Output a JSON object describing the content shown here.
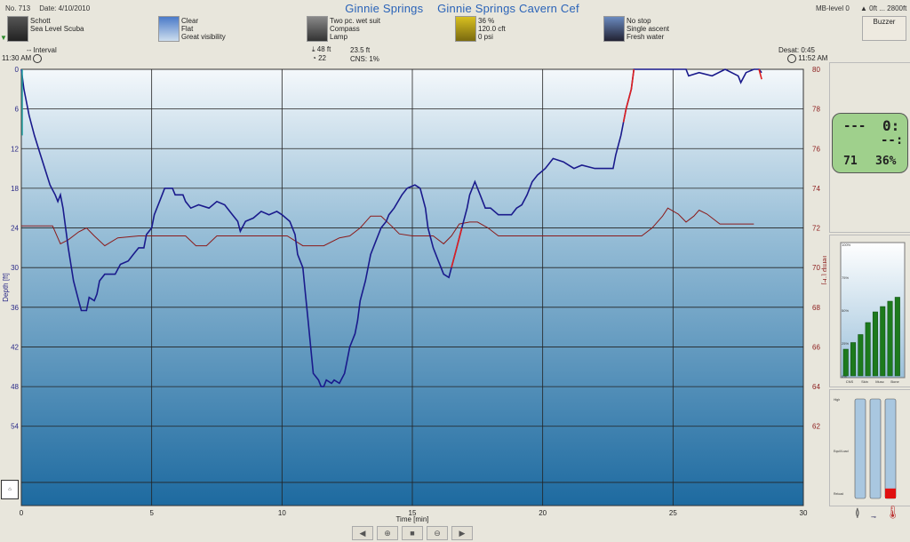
{
  "header": {
    "dive_no": "No. 713",
    "date": "Date: 4/10/2010",
    "title_site": "Ginnie Springs",
    "title_location": "Ginnie Springs Cavern Cef",
    "mb_level": "MB-level 0",
    "altitude": "0ft ... 2800ft",
    "buzzer_label": "Buzzer"
  },
  "info": {
    "diver": [
      "Schott",
      "Sea Level Scuba"
    ],
    "weather": [
      "Clear",
      "Flat",
      "Great visibility"
    ],
    "equipment": [
      "Two pc. wet suit",
      "Compass",
      "Lamp"
    ],
    "tank": [
      "36 %",
      "120.0 cft",
      "0 psi"
    ],
    "deco": [
      "No stop",
      "Single ascent",
      "Fresh water"
    ]
  },
  "subheader": {
    "interval_label": "--  Interval",
    "start_time": "11:30 AM",
    "max_depth": "48 ft",
    "avg_depth": "23.5 ft",
    "cns_left": "22",
    "cns": "CNS:  1%",
    "desat": "Desat:  0:45",
    "end_time": "11:52 AM"
  },
  "computer": {
    "top_left": "---",
    "top_right": "0:",
    "mid_right": "--:",
    "bottom_left": "71",
    "bottom_right": "36%"
  },
  "bars_panel": {
    "labels": [
      "CNS",
      "Skin",
      "Musc",
      "Bone"
    ],
    "y_labels": [
      "100%",
      "75%",
      "50%",
      "25%",
      "0%"
    ],
    "values": [
      0.2,
      0.25,
      0.31,
      0.4,
      0.48,
      0.52,
      0.56,
      0.59
    ]
  },
  "tissue_panel": {
    "labels": [
      "High",
      "Equil/Load",
      "Reload"
    ],
    "values": [
      0,
      0,
      0.1
    ]
  },
  "chart_data": {
    "type": "line",
    "xlabel": "Time [min]",
    "ylabel": "Depth [ft]",
    "y2label": "Temp [°F]",
    "xlim": [
      0,
      30
    ],
    "ylim": [
      66,
      0
    ],
    "y2lim": [
      58,
      80
    ],
    "x_ticks": [
      0,
      5,
      10,
      15,
      20,
      25,
      30
    ],
    "y_ticks": [
      0,
      6,
      12,
      18,
      24,
      30,
      36,
      42,
      48,
      54
    ],
    "y2_ticks": [
      80,
      78,
      76,
      74,
      72,
      70,
      68,
      66,
      64,
      62
    ],
    "depth": {
      "name": "Depth",
      "color": "#1a1a8c",
      "points": [
        [
          0,
          0
        ],
        [
          0.1,
          3
        ],
        [
          0.3,
          7
        ],
        [
          0.5,
          10
        ],
        [
          0.7,
          12.5
        ],
        [
          0.9,
          15
        ],
        [
          1.1,
          17.5
        ],
        [
          1.3,
          19
        ],
        [
          1.4,
          20
        ],
        [
          1.5,
          19
        ],
        [
          1.6,
          21
        ],
        [
          1.8,
          27
        ],
        [
          2.0,
          32
        ],
        [
          2.2,
          35
        ],
        [
          2.3,
          36.5
        ],
        [
          2.5,
          36.5
        ],
        [
          2.6,
          34.5
        ],
        [
          2.8,
          35
        ],
        [
          2.9,
          34
        ],
        [
          3.0,
          32
        ],
        [
          3.2,
          31
        ],
        [
          3.6,
          31
        ],
        [
          3.8,
          29.5
        ],
        [
          4.1,
          29
        ],
        [
          4.3,
          28
        ],
        [
          4.5,
          27
        ],
        [
          4.7,
          27
        ],
        [
          4.8,
          25
        ],
        [
          5.0,
          24
        ],
        [
          5.1,
          22
        ],
        [
          5.3,
          20
        ],
        [
          5.5,
          18
        ],
        [
          5.8,
          18
        ],
        [
          5.9,
          19
        ],
        [
          6.2,
          19
        ],
        [
          6.3,
          20
        ],
        [
          6.5,
          21
        ],
        [
          6.8,
          20.5
        ],
        [
          7.2,
          21
        ],
        [
          7.5,
          20
        ],
        [
          7.8,
          20.5
        ],
        [
          8.1,
          22
        ],
        [
          8.3,
          23
        ],
        [
          8.4,
          24.5
        ],
        [
          8.6,
          23
        ],
        [
          8.9,
          22.5
        ],
        [
          9.2,
          21.5
        ],
        [
          9.5,
          22
        ],
        [
          9.8,
          21.5
        ],
        [
          10.0,
          22
        ],
        [
          10.3,
          23
        ],
        [
          10.5,
          25
        ],
        [
          10.6,
          28
        ],
        [
          10.8,
          30
        ],
        [
          10.9,
          34
        ],
        [
          11.0,
          38
        ],
        [
          11.1,
          42
        ],
        [
          11.2,
          46
        ],
        [
          11.4,
          47
        ],
        [
          11.5,
          48
        ],
        [
          11.6,
          48
        ],
        [
          11.7,
          47
        ],
        [
          11.9,
          47.5
        ],
        [
          12.0,
          47
        ],
        [
          12.2,
          47.5
        ],
        [
          12.4,
          46
        ],
        [
          12.5,
          44
        ],
        [
          12.6,
          42
        ],
        [
          12.8,
          40
        ],
        [
          12.9,
          38
        ],
        [
          13.0,
          35
        ],
        [
          13.2,
          32
        ],
        [
          13.4,
          28
        ],
        [
          13.6,
          26
        ],
        [
          13.8,
          24
        ],
        [
          14.0,
          23
        ],
        [
          14.1,
          22
        ],
        [
          14.3,
          21
        ],
        [
          14.6,
          19
        ],
        [
          14.8,
          18
        ],
        [
          15.1,
          17.5
        ],
        [
          15.3,
          18
        ],
        [
          15.5,
          21
        ],
        [
          15.6,
          24
        ],
        [
          15.8,
          27
        ],
        [
          16.0,
          29
        ],
        [
          16.2,
          31
        ],
        [
          16.4,
          31.5
        ],
        [
          16.5,
          30
        ],
        [
          16.7,
          27
        ],
        [
          16.9,
          24
        ],
        [
          17.1,
          21
        ],
        [
          17.2,
          19
        ],
        [
          17.4,
          17
        ],
        [
          17.6,
          19
        ],
        [
          17.8,
          21
        ],
        [
          18.0,
          21
        ],
        [
          18.3,
          22
        ],
        [
          18.8,
          22
        ],
        [
          19.0,
          21
        ],
        [
          19.2,
          20.5
        ],
        [
          19.4,
          19
        ],
        [
          19.6,
          17
        ],
        [
          19.8,
          16
        ],
        [
          20.1,
          15
        ],
        [
          20.4,
          13.5
        ],
        [
          20.8,
          14
        ],
        [
          21.2,
          15
        ],
        [
          21.5,
          14.5
        ],
        [
          22.0,
          15
        ],
        [
          22.7,
          15
        ],
        [
          22.8,
          13
        ],
        [
          23.0,
          10
        ],
        [
          23.1,
          8
        ],
        [
          23.2,
          6
        ],
        [
          23.4,
          3
        ],
        [
          23.5,
          0
        ],
        [
          25.5,
          0
        ],
        [
          25.6,
          1
        ],
        [
          26,
          0.5
        ],
        [
          26.5,
          1
        ],
        [
          27,
          0
        ],
        [
          27.5,
          1
        ],
        [
          27.6,
          2
        ],
        [
          27.8,
          0.5
        ],
        [
          28.1,
          0
        ],
        [
          28.3,
          0
        ],
        [
          28.4,
          0.5
        ]
      ]
    },
    "temperature": {
      "name": "Temperature",
      "color": "#8b1a1a",
      "points": [
        [
          0,
          72.1
        ],
        [
          1.2,
          72.1
        ],
        [
          1.5,
          71.2
        ],
        [
          1.8,
          71.4
        ],
        [
          2.2,
          71.8
        ],
        [
          2.5,
          72.0
        ],
        [
          2.8,
          71.6
        ],
        [
          3.2,
          71.1
        ],
        [
          3.7,
          71.5
        ],
        [
          4.5,
          71.6
        ],
        [
          5.5,
          71.6
        ],
        [
          6.3,
          71.6
        ],
        [
          6.7,
          71.1
        ],
        [
          7.1,
          71.1
        ],
        [
          7.5,
          71.6
        ],
        [
          8.5,
          71.6
        ],
        [
          9.5,
          71.6
        ],
        [
          10.2,
          71.6
        ],
        [
          10.8,
          71.1
        ],
        [
          11.6,
          71.1
        ],
        [
          12.2,
          71.5
        ],
        [
          12.6,
          71.6
        ],
        [
          13.0,
          72.0
        ],
        [
          13.4,
          72.6
        ],
        [
          13.8,
          72.6
        ],
        [
          14.2,
          72.1
        ],
        [
          14.5,
          71.7
        ],
        [
          15.0,
          71.6
        ],
        [
          15.8,
          71.6
        ],
        [
          16.2,
          71.2
        ],
        [
          16.5,
          71.6
        ],
        [
          16.8,
          72.2
        ],
        [
          17.2,
          72.3
        ],
        [
          17.5,
          72.3
        ],
        [
          17.9,
          72.0
        ],
        [
          18.3,
          71.6
        ],
        [
          19.0,
          71.6
        ],
        [
          20.0,
          71.6
        ],
        [
          21.0,
          71.6
        ],
        [
          22.0,
          71.6
        ],
        [
          23.0,
          71.6
        ],
        [
          23.8,
          71.6
        ],
        [
          24.2,
          72.0
        ],
        [
          24.6,
          72.6
        ],
        [
          24.8,
          73.0
        ],
        [
          25.2,
          72.7
        ],
        [
          25.5,
          72.3
        ],
        [
          25.8,
          72.6
        ],
        [
          26.0,
          72.9
        ],
        [
          26.3,
          72.7
        ],
        [
          26.8,
          72.2
        ],
        [
          27.4,
          72.2
        ],
        [
          28.1,
          72.2
        ]
      ]
    }
  },
  "toolbar": {
    "prev": "◀",
    "zoom_in": "⊕",
    "stop": "■",
    "zoom_out": "⊖",
    "next": "▶"
  }
}
